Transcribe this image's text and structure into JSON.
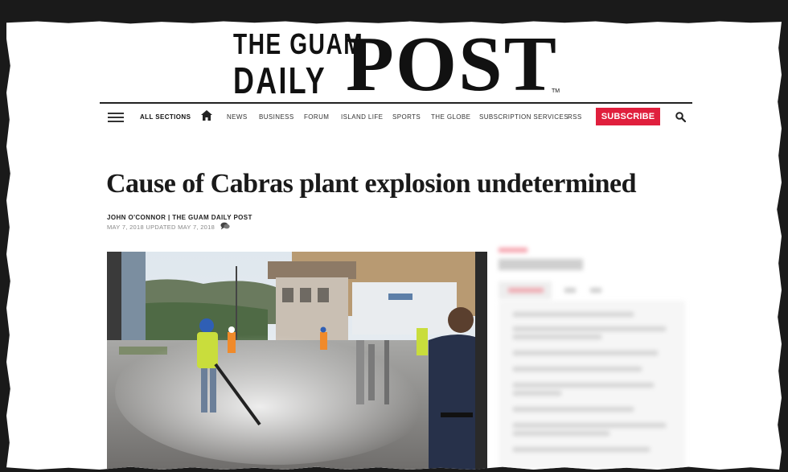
{
  "masthead": {
    "line1": "THE GUAM",
    "line2": "DAILY",
    "word": "POST",
    "tm": "TM"
  },
  "nav": {
    "all_sections": "ALL SECTIONS",
    "items": [
      "NEWS",
      "BUSINESS",
      "FORUM",
      "ISLAND LIFE",
      "SPORTS",
      "THE GLOBE",
      "SUBSCRIPTION SERVICES",
      "RSS"
    ],
    "subscribe": "SUBSCRIBE",
    "icons": [
      "hamburger-menu-icon",
      "home-icon",
      "search-icon"
    ]
  },
  "article": {
    "headline": "Cause of Cabras plant explosion undetermined",
    "byline": "JOHN O'CONNOR | THE GUAM DAILY POST",
    "dates": "MAY 7, 2018 UPDATED MAY 7, 2018",
    "comment_icon": "comment-bubble-icon"
  },
  "colors": {
    "accent": "#e01f3d",
    "text": "#1a1a1a",
    "muted": "#888888",
    "background_frame": "#1a1a1a"
  }
}
